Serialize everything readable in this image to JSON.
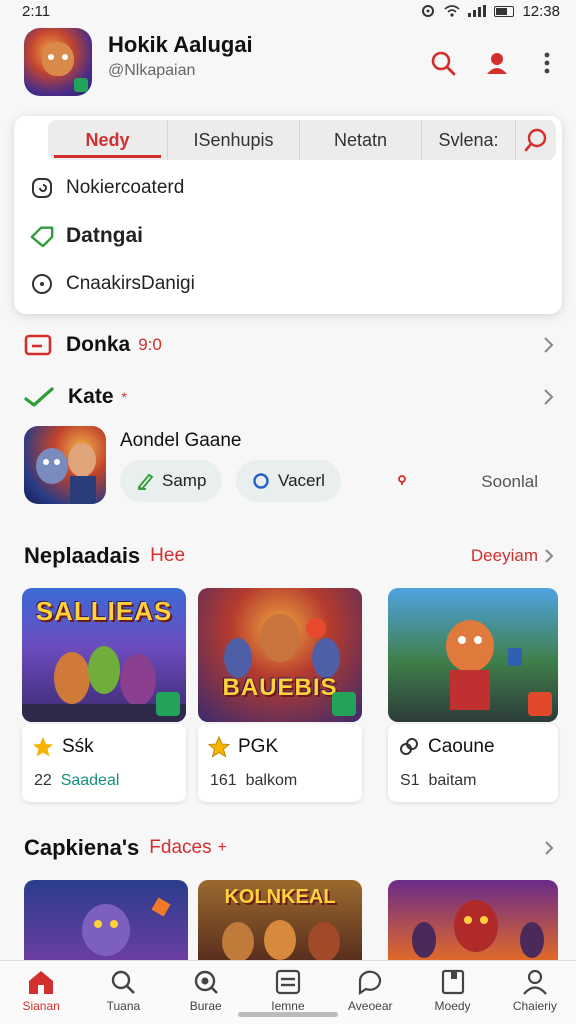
{
  "status": {
    "time": "2:11",
    "clock": "12:38"
  },
  "header": {
    "title": "Hokik Aalugai",
    "handle": "@Nlkapaian"
  },
  "dropdown": {
    "tabs": [
      {
        "label": "Nedy"
      },
      {
        "label": "ISenhupis"
      },
      {
        "label": "Netatn"
      },
      {
        "label": "Svlena:"
      }
    ],
    "items": [
      {
        "label": "Nokiercoaterd",
        "icon": "settings-circle-icon"
      },
      {
        "label": "Datngai",
        "icon": "tag-icon"
      },
      {
        "label": "CnaakirsDanigi",
        "icon": "circle-dot-icon"
      }
    ]
  },
  "rows": {
    "donka": {
      "label": "Donka",
      "sub": "9:0"
    },
    "kate": {
      "label": "Kate",
      "sub": "*"
    }
  },
  "game": {
    "title": "Aondel Gaane",
    "pill1": "Samp",
    "pill2": "Vacerl",
    "soon": "Soonlal"
  },
  "section1": {
    "title": "Neplaadais",
    "tag": "Hee",
    "more": "Deeyiam"
  },
  "cards": [
    {
      "art": "SALLIEAS",
      "name": "Sśk",
      "count": "22",
      "meta": "Saadeal",
      "icon": "star-icon"
    },
    {
      "art": "BAUEBIS",
      "name": "PGK",
      "count": "161",
      "meta": "balkom",
      "icon": "star-outline-icon"
    },
    {
      "art": "",
      "name": "Caoune",
      "count": "S1",
      "meta": "baitam",
      "icon": "link-icon"
    }
  ],
  "section2": {
    "title": "Capkiena's",
    "tag": "Fdaces",
    "mark": "+"
  },
  "row2": [
    {
      "art": ""
    },
    {
      "art": "KOLNKEAL"
    },
    {
      "art": ""
    }
  ],
  "nav": [
    {
      "label": "Sianan"
    },
    {
      "label": "Tuana"
    },
    {
      "label": "Burae"
    },
    {
      "label": "Iemne"
    },
    {
      "label": "Aveoear"
    },
    {
      "label": "Moedy"
    },
    {
      "label": "Chaieriy"
    }
  ],
  "colors": {
    "accent": "#d32f2f",
    "green": "#2e9d3a",
    "teal": "#16907f"
  }
}
